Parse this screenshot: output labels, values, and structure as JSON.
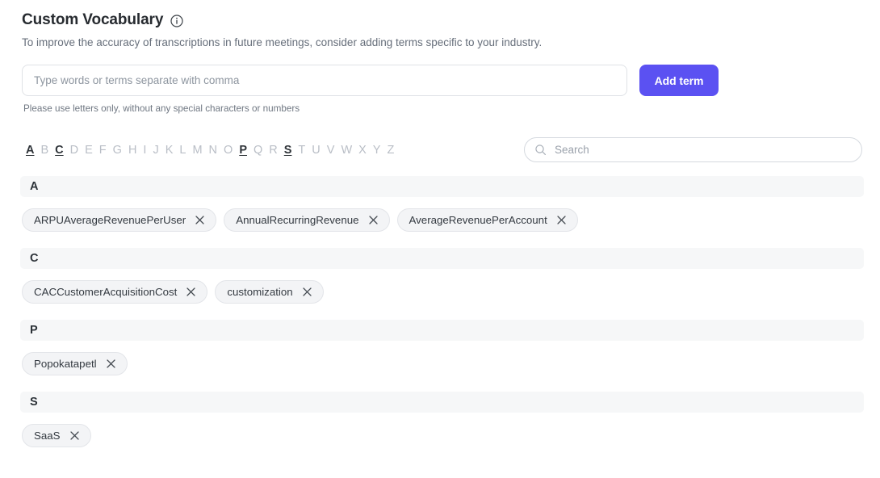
{
  "header": {
    "title": "Custom Vocabulary",
    "info_icon": "info-circle-icon",
    "subtitle": "To improve the accuracy of transcriptions in future meetings, consider adding terms specific to your industry."
  },
  "form": {
    "input_value": "",
    "input_placeholder": "Type words or terms separate with comma",
    "add_button_label": "Add term",
    "hint": "Please use letters only, without any special characters or numbers",
    "accent_color": "#5b51f2"
  },
  "alphabet": {
    "letters": [
      {
        "label": "A",
        "active": true
      },
      {
        "label": "B",
        "active": false
      },
      {
        "label": "C",
        "active": true
      },
      {
        "label": "D",
        "active": false
      },
      {
        "label": "E",
        "active": false
      },
      {
        "label": "F",
        "active": false
      },
      {
        "label": "G",
        "active": false
      },
      {
        "label": "H",
        "active": false
      },
      {
        "label": "I",
        "active": false
      },
      {
        "label": "J",
        "active": false
      },
      {
        "label": "K",
        "active": false
      },
      {
        "label": "L",
        "active": false
      },
      {
        "label": "M",
        "active": false
      },
      {
        "label": "N",
        "active": false
      },
      {
        "label": "O",
        "active": false
      },
      {
        "label": "P",
        "active": true
      },
      {
        "label": "Q",
        "active": false
      },
      {
        "label": "R",
        "active": false
      },
      {
        "label": "S",
        "active": true
      },
      {
        "label": "T",
        "active": false
      },
      {
        "label": "U",
        "active": false
      },
      {
        "label": "V",
        "active": false
      },
      {
        "label": "W",
        "active": false
      },
      {
        "label": "X",
        "active": false
      },
      {
        "label": "Y",
        "active": false
      },
      {
        "label": "Z",
        "active": false
      }
    ]
  },
  "search": {
    "icon": "search-icon",
    "value": "",
    "placeholder": "Search"
  },
  "groups": [
    {
      "letter": "A",
      "terms": [
        "ARPUAverageRevenuePerUser",
        "AnnualRecurringRevenue",
        "AverageRevenuePerAccount"
      ]
    },
    {
      "letter": "C",
      "terms": [
        "CACCustomerAcquisitionCost",
        "customization"
      ]
    },
    {
      "letter": "P",
      "terms": [
        "Popokatapetl"
      ]
    },
    {
      "letter": "S",
      "terms": [
        "SaaS"
      ]
    }
  ],
  "colors": {
    "accent": "#5b51f2",
    "group_band": "#f6f7f8",
    "chip_bg": "#f3f4f6",
    "text": "#2e3338",
    "muted": "#8d959f"
  }
}
